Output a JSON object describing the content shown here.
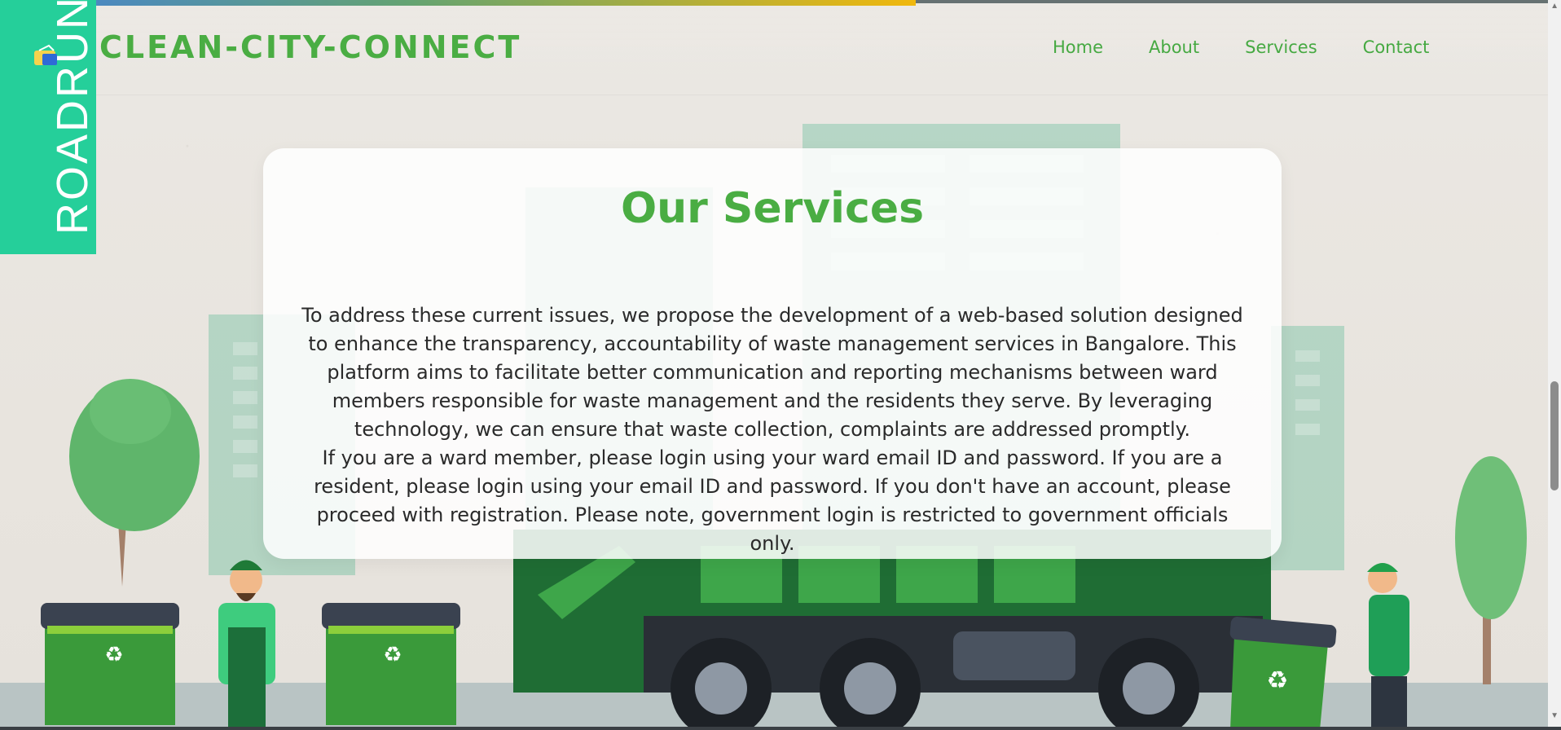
{
  "brand": {
    "logo_text": "ROADRUN",
    "site_title": "CLEAN-CITY-CONNECT"
  },
  "nav": {
    "items": [
      {
        "label": "Home"
      },
      {
        "label": "About"
      },
      {
        "label": "Services"
      },
      {
        "label": "Contact"
      }
    ]
  },
  "main": {
    "title": "Our Services",
    "paragraph_1": "To address these current issues, we propose the development of a web-based solution designed to enhance the transparency, accountability of waste management services in Bangalore. This platform aims to facilitate better communication and reporting mechanisms between ward members responsible for waste management and the residents they serve. By leveraging technology, we can ensure that waste collection, complaints are addressed promptly.",
    "paragraph_2": "If you are a ward member, please login using your ward email ID and password. If you are a resident, please login using your email ID and password. If you don't have an account, please proceed with registration. Please note, government login is restricted to government officials only."
  },
  "colors": {
    "accent_green": "#4aad43",
    "logo_box": "#25cf9a"
  }
}
